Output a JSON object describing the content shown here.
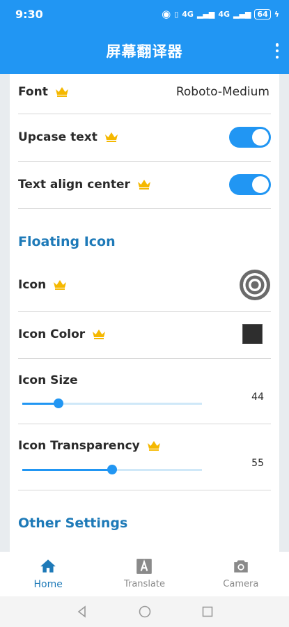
{
  "status_bar": {
    "time": "9:30",
    "network": "4G",
    "battery": "64"
  },
  "app": {
    "title": "屏幕翻译器"
  },
  "settings": {
    "font_label": "Font",
    "font_value": "Roboto-Medium",
    "upcase_label": "Upcase text",
    "upcase_on": true,
    "align_label": "Text align center",
    "align_on": true
  },
  "floating_icon": {
    "title": "Floating Icon",
    "icon_label": "Icon",
    "icon_color_label": "Icon Color",
    "icon_color": "#2e2e2e",
    "icon_size_label": "Icon Size",
    "icon_size_value": "44",
    "icon_size_fraction": 0.2,
    "transparency_label": "Icon Transparency",
    "transparency_value": "55",
    "transparency_fraction": 0.5
  },
  "other_settings": {
    "title": "Other Settings"
  },
  "bottom_nav": {
    "items": [
      {
        "label": "Home",
        "icon": "home-icon",
        "active": true
      },
      {
        "label": "Translate",
        "icon": "translate-icon",
        "active": false
      },
      {
        "label": "Camera",
        "icon": "camera-icon",
        "active": false
      }
    ]
  },
  "colors": {
    "accent": "#2196f3",
    "section_title": "#1e7ab8",
    "crown": "#f5b800"
  }
}
